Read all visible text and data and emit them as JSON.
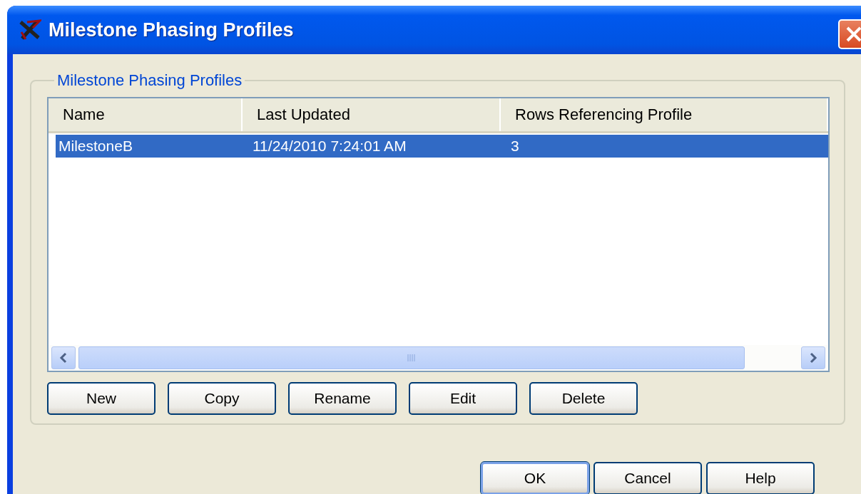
{
  "window": {
    "title": "Milestone Phasing Profiles"
  },
  "group": {
    "label": "Milestone Phasing Profiles"
  },
  "table": {
    "columns": [
      "Name",
      "Last Updated",
      "Rows Referencing Profile"
    ],
    "rows": [
      {
        "cells": [
          "MilestoneB",
          "11/24/2010 7:24:01 AM",
          "3"
        ],
        "selected": true
      }
    ]
  },
  "actions": [
    "New",
    "Copy",
    "Rename",
    "Edit",
    "Delete"
  ],
  "dialog_buttons": [
    {
      "label": "OK",
      "default": true
    },
    {
      "label": "Cancel",
      "default": false
    },
    {
      "label": "Help",
      "default": false
    }
  ]
}
